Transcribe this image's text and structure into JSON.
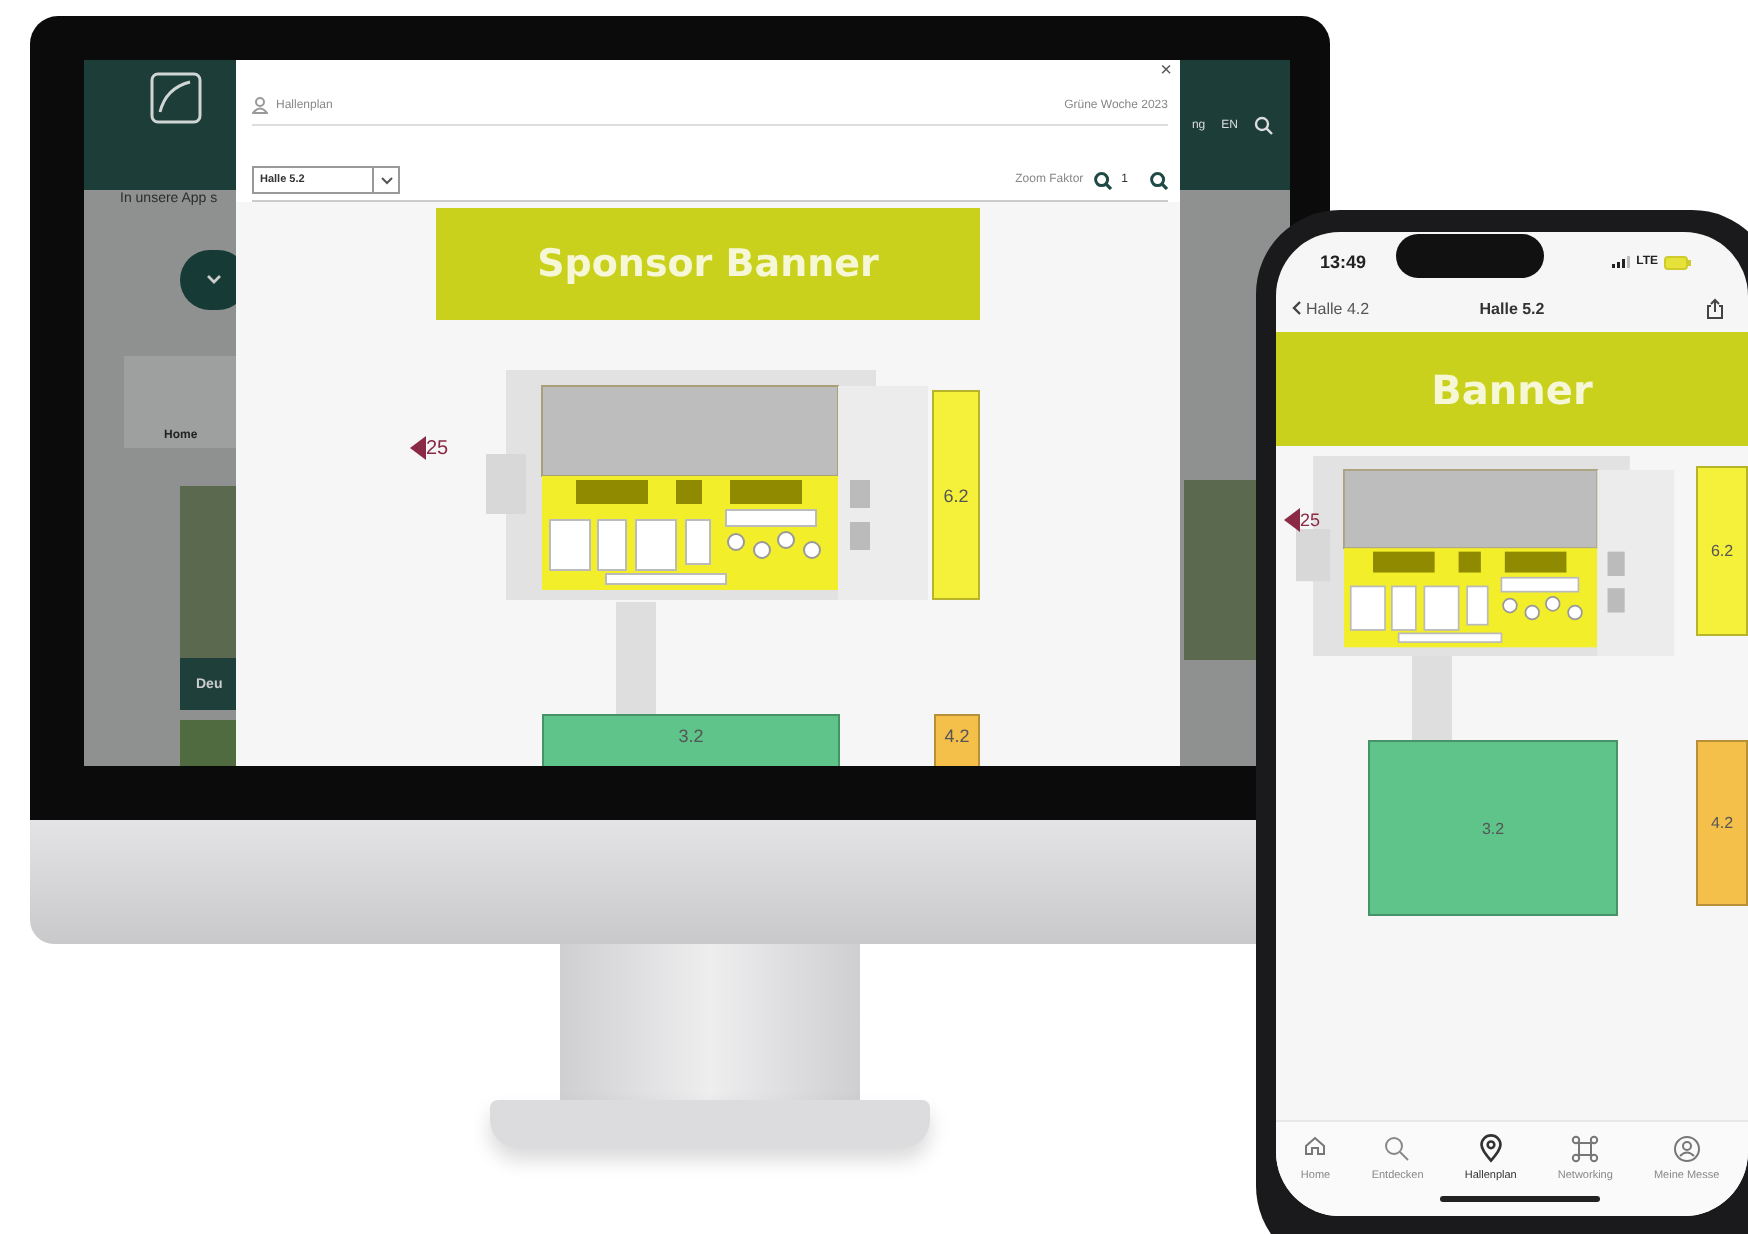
{
  "desktop": {
    "background": {
      "header_right": [
        "ng",
        "EN"
      ],
      "intro_text": "In unsere App s",
      "breadcrumb": "Home",
      "card_title": "Deu"
    },
    "modal": {
      "close": "×",
      "title": "Hallenplan",
      "event": "Grüne Woche 2023",
      "hall_select": {
        "value": "Halle 5.2"
      },
      "zoom_label": "Zoom Faktor",
      "zoom_value": "1",
      "map": {
        "banner": "Sponsor Banner",
        "marker": "25",
        "halls": [
          {
            "label": "6.2",
            "color": "#f5f03a"
          },
          {
            "label": "3.2",
            "color": "#5ec48a"
          },
          {
            "label": "4.2",
            "color": "#f5c04a"
          }
        ]
      }
    }
  },
  "phone": {
    "status": {
      "time": "13:49",
      "network": "LTE"
    },
    "nav": {
      "back": "Halle 4.2",
      "title": "Halle 5.2"
    },
    "map": {
      "banner": "Banner",
      "marker": "25",
      "halls": [
        {
          "label": "6.2",
          "color": "#f5f03a"
        },
        {
          "label": "3.2",
          "color": "#5ec48a"
        },
        {
          "label": "4.2",
          "color": "#f5c04a"
        }
      ]
    },
    "tabs": [
      {
        "label": "Home",
        "selected": false
      },
      {
        "label": "Entdecken",
        "selected": false
      },
      {
        "label": "Hallenplan",
        "selected": true
      },
      {
        "label": "Networking",
        "selected": false
      },
      {
        "label": "Meine Messe",
        "selected": false
      }
    ]
  }
}
